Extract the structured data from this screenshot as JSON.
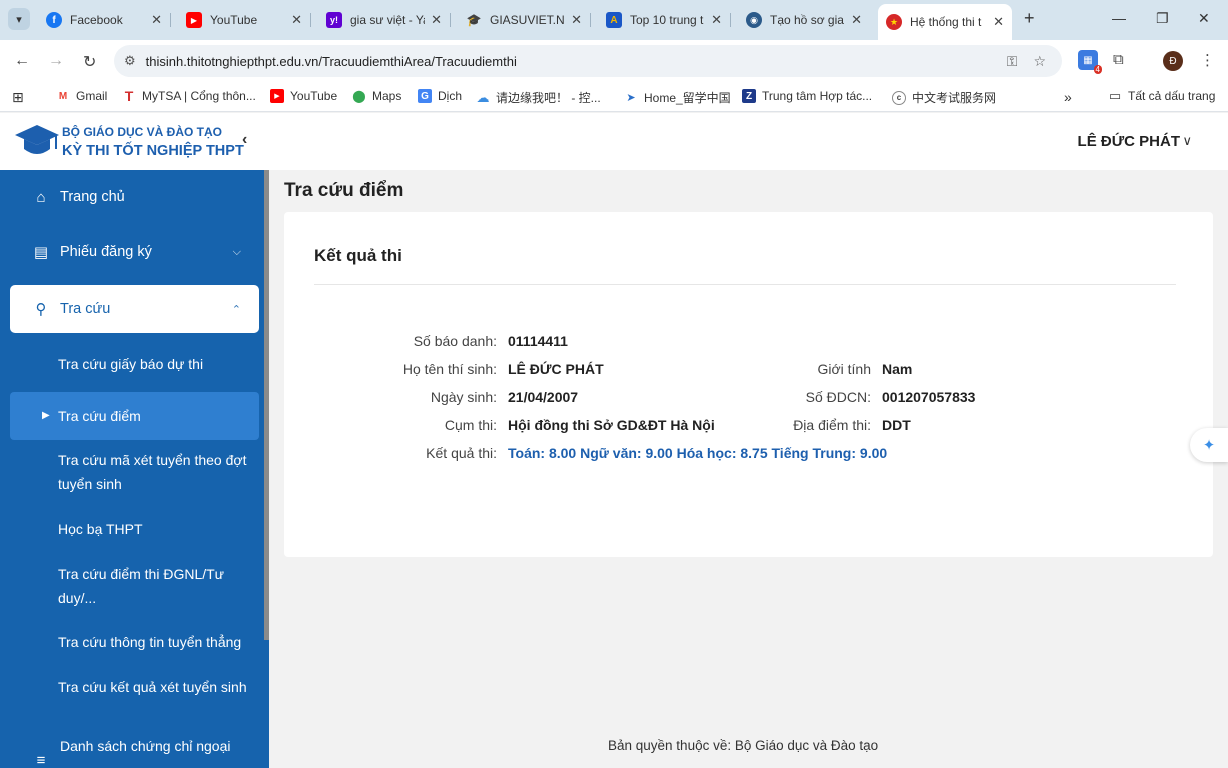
{
  "browser": {
    "tabs": [
      {
        "title": "Facebook",
        "icon": "facebook-icon",
        "color": "#1877f2",
        "glyph": "f"
      },
      {
        "title": "YouTube",
        "icon": "youtube-icon",
        "color": "#ff0000",
        "glyph": "▶"
      },
      {
        "title": "gia sư việt - Ya",
        "icon": "yahoo-icon",
        "color": "#6001d2",
        "glyph": "y!"
      },
      {
        "title": "GIASUVIET.NE",
        "icon": "graduation-icon",
        "color": "#444444",
        "glyph": "🎓"
      },
      {
        "title": "Top 10 trung t",
        "icon": "a-logo-icon",
        "color": "#1a57c7",
        "glyph": "A"
      },
      {
        "title": "Tạo hồ sơ gia",
        "icon": "globe-icon",
        "color": "#2b5a8a",
        "glyph": "◉"
      },
      {
        "title": "Hệ thống thi t",
        "icon": "emblem-icon",
        "color": "#d62828",
        "glyph": "★"
      }
    ],
    "url": "thisinh.thitotnghiepthpt.edu.vn/TracuudiemthiArea/Tracuudiemthi",
    "extension_badge": "4",
    "profile_initial": "Đ",
    "bookmarks": [
      {
        "label": "Gmail",
        "icon": "gmail-icon",
        "color": "#ea4335",
        "glyph": "M"
      },
      {
        "label": "MyTSA | Cổng thôn...",
        "icon": "t-logo-icon",
        "color": "#d32f2f",
        "glyph": "T"
      },
      {
        "label": "YouTube",
        "icon": "youtube-icon",
        "color": "#ff0000",
        "glyph": "▶"
      },
      {
        "label": "Maps",
        "icon": "maps-icon",
        "color": "#34a853",
        "glyph": "⬤"
      },
      {
        "label": "Dịch",
        "icon": "translate-icon",
        "color": "#4285f4",
        "glyph": "G"
      },
      {
        "label": "请边缘我吧！ - 控...",
        "icon": "cloud-icon",
        "color": "#3b8de0",
        "glyph": "☁"
      },
      {
        "label": "Home_留学中国",
        "icon": "arrow-logo-icon",
        "color": "#2a6fc9",
        "glyph": "➤"
      },
      {
        "label": "Trung tâm Hợp tác...",
        "icon": "zh-logo-icon",
        "color": "#1e3a8a",
        "glyph": "Z"
      },
      {
        "label": "中文考试服务网",
        "icon": "cti-logo-icon",
        "color": "#444444",
        "glyph": "c"
      }
    ],
    "all_bookmarks": "Tất cả dấu trang"
  },
  "header": {
    "brand_line1": "BỘ GIÁO DỤC VÀ ĐÀO TẠO",
    "brand_line2": "KỲ THI TỐT NGHIỆP THPT",
    "user_name": "LÊ ĐỨC PHÁT"
  },
  "sidebar": {
    "home": "Trang chủ",
    "registration": "Phiếu đăng ký",
    "lookup": "Tra cứu",
    "sub_items": [
      "Tra cứu giấy báo dự thi",
      "Tra cứu điểm",
      "Tra cứu mã xét tuyển theo đợt tuyển sinh",
      "Học bạ THPT",
      "Tra cứu điểm thi ĐGNL/Tư duy/...",
      "Tra cứu thông tin tuyển thẳng",
      "Tra cứu kết quả xét tuyển sinh",
      "Danh sách chứng chỉ ngoại"
    ]
  },
  "main": {
    "page_title": "Tra cứu điểm",
    "card_title": "Kết quả thi",
    "fields": {
      "sbd_label": "Số báo danh:",
      "sbd_value": "01114411",
      "name_label": "Họ tên thí sinh:",
      "name_value": "LÊ ĐỨC PHÁT",
      "gender_label": "Giới tính",
      "gender_value": "Nam",
      "dob_label": "Ngày sinh:",
      "dob_value": "21/04/2007",
      "id_label": "Số ĐDCN:",
      "id_value": "001207057833",
      "cluster_label": "Cụm thi:",
      "cluster_value": "Hội đồng thi Sở GD&ĐT Hà Nội",
      "site_label": "Địa điểm thi:",
      "site_value": "DDT",
      "result_label": "Kết quả thi:",
      "result_value": "Toán: 8.00 Ngữ văn: 9.00 Hóa học: 8.75 Tiếng Trung: 9.00"
    }
  },
  "footer": "Bản quyền thuộc về: Bộ Giáo dục và Đào tạo",
  "colors": {
    "primary": "#1663ad",
    "active_item": "#2f7fd0",
    "result_blue": "#1d5fae"
  }
}
